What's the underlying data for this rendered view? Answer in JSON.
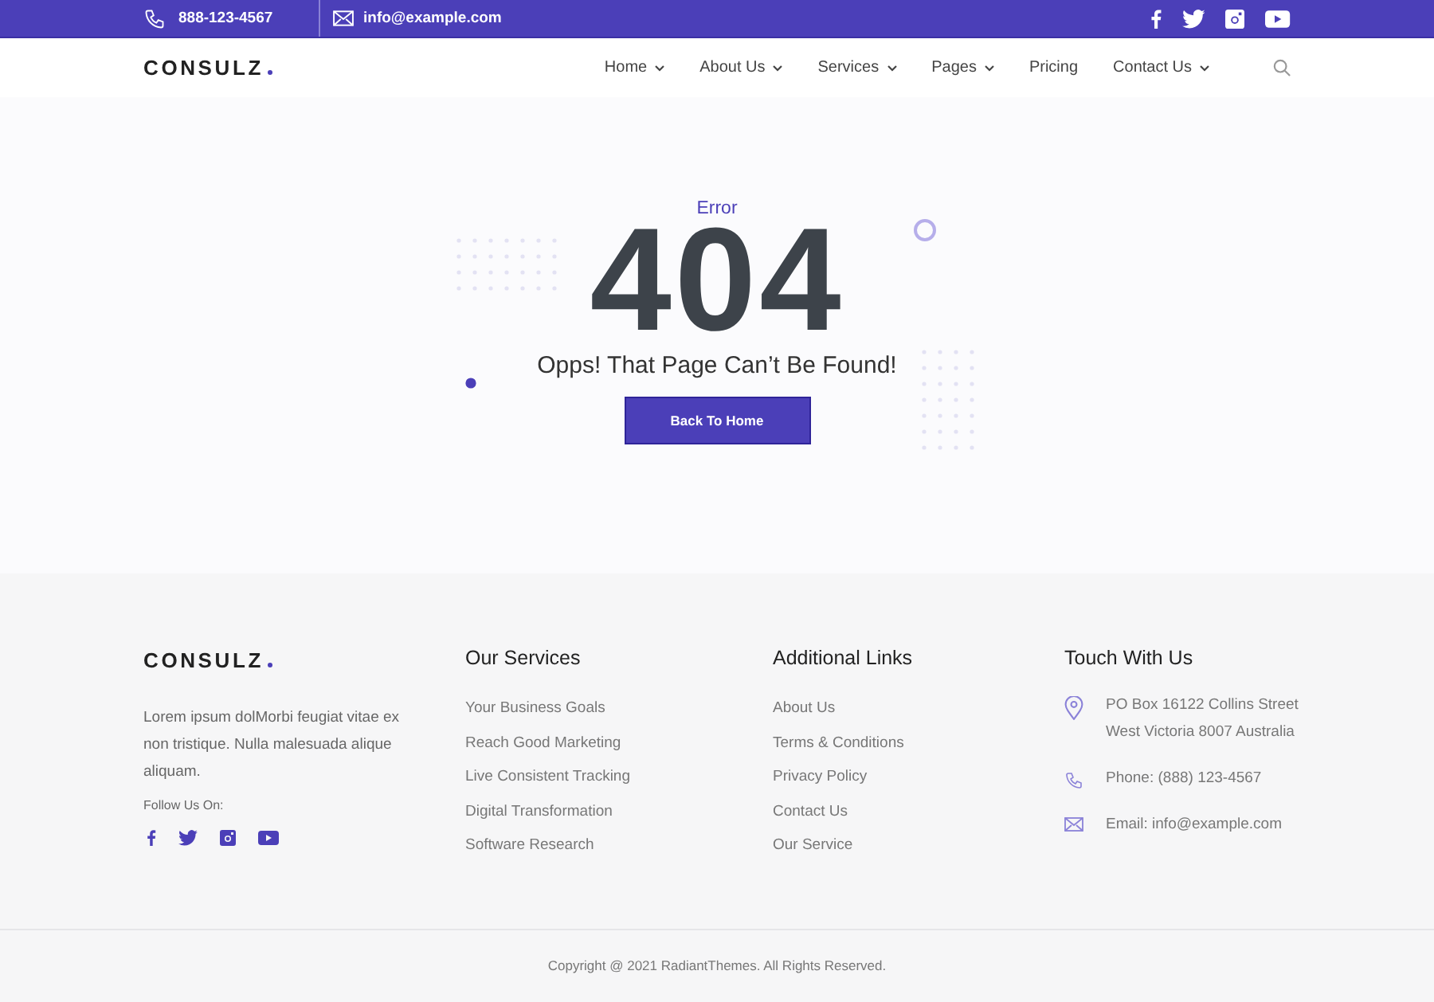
{
  "topbar": {
    "phone": "888-123-4567",
    "email": "info@example.com"
  },
  "header": {
    "logo": "CONSULZ",
    "nav": [
      {
        "label": "Home",
        "has_dropdown": true
      },
      {
        "label": "About Us",
        "has_dropdown": true
      },
      {
        "label": "Services",
        "has_dropdown": true
      },
      {
        "label": "Pages",
        "has_dropdown": true
      },
      {
        "label": "Pricing",
        "has_dropdown": false
      },
      {
        "label": "Contact Us",
        "has_dropdown": true
      }
    ]
  },
  "error": {
    "eyebrow": "Error",
    "code": "404",
    "message": "Opps! That Page Can’t Be Found!",
    "button": "Back To Home"
  },
  "footer": {
    "logo": "CONSULZ",
    "about": "Lorem ipsum dolMorbi feugiat vitae ex non tristique. Nulla malesuada alique aliquam.",
    "follow_label": "Follow Us On:",
    "columns": [
      {
        "title": "Our Services",
        "links": [
          "Your Business Goals",
          "Reach Good Marketing",
          "Live Consistent Tracking",
          "Digital Transformation",
          "Software Research"
        ]
      },
      {
        "title": "Additional Links",
        "links": [
          "About Us",
          "Terms & Conditions",
          "Privacy Policy",
          "Contact Us",
          "Our Service"
        ]
      }
    ],
    "contact": {
      "title": "Touch With Us",
      "items": [
        {
          "kind": "address",
          "lines": [
            "PO Box 16122 Collins Street",
            "West Victoria 8007 Australia"
          ]
        },
        {
          "kind": "phone",
          "lines": [
            "Phone: (888) 123-4567"
          ]
        },
        {
          "kind": "email",
          "lines": [
            "Email: info@example.com"
          ]
        }
      ]
    },
    "copyright": "Copyright @ 2021 RadiantThemes. All Rights Reserved."
  }
}
